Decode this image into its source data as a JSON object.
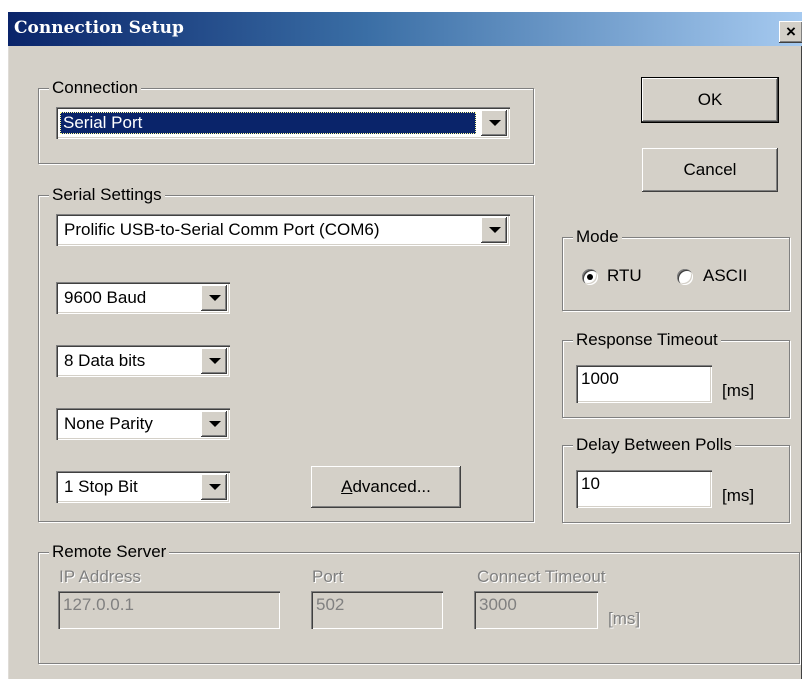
{
  "window": {
    "title": "Connection Setup",
    "close_glyph": "×"
  },
  "connection": {
    "label": "Connection",
    "value": "Serial Port"
  },
  "serial_settings": {
    "label": "Serial Settings",
    "port": "Prolific USB-to-Serial Comm Port (COM6)",
    "baud": "9600 Baud",
    "data_bits": "8 Data bits",
    "parity": "None Parity",
    "stop_bits": "1 Stop Bit",
    "advanced_prefix": "A",
    "advanced_rest": "dvanced..."
  },
  "buttons": {
    "ok": "OK",
    "cancel": "Cancel"
  },
  "mode": {
    "label": "Mode",
    "options": [
      "RTU",
      "ASCII"
    ],
    "selected": "RTU"
  },
  "response_timeout": {
    "label": "Response Timeout",
    "value": "1000",
    "unit": "[ms]"
  },
  "delay_between_polls": {
    "label": "Delay Between Polls",
    "value": "10",
    "unit": "[ms]"
  },
  "remote_server": {
    "label": "Remote Server",
    "ip_label": "IP Address",
    "ip_value": "127.0.0.1",
    "port_label": "Port",
    "port_value": "502",
    "timeout_label": "Connect Timeout",
    "timeout_value": "3000",
    "timeout_unit": "[ms]"
  },
  "icons": {
    "dropdown": "chevron-down-icon",
    "close": "close-icon"
  }
}
